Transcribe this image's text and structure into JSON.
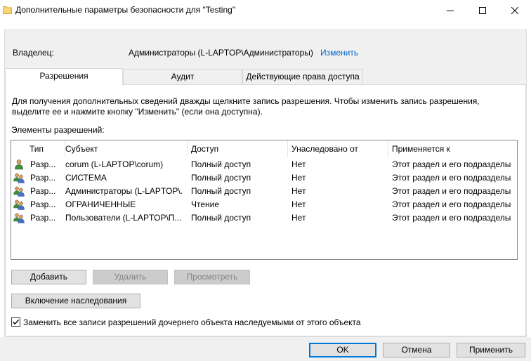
{
  "window": {
    "title": "Дополнительные параметры безопасности  для \"Testing\"",
    "icons": {
      "app": "folder-icon",
      "minimize": "minimize-icon",
      "maximize": "maximize-icon",
      "close": "close-icon"
    }
  },
  "owner": {
    "label": "Владелец:",
    "value": "Администраторы (L-LAPTOP\\Администраторы)",
    "change_link": "Изменить"
  },
  "tabs": [
    {
      "label": "Разрешения",
      "active": true
    },
    {
      "label": "Аудит",
      "active": false
    },
    {
      "label": "Действующие права доступа",
      "active": false
    }
  ],
  "info_text": "Для получения дополнительных сведений дважды щелкните запись разрешения. Чтобы изменить запись разрешения, выделите ее и нажмите кнопку \"Изменить\" (если она доступна).",
  "permissions_label": "Элементы разрешений:",
  "columns": [
    "Тип",
    "Субъект",
    "Доступ",
    "Унаследовано от",
    "Применяется к"
  ],
  "rows": [
    {
      "icon": "user-icon",
      "type": "Разр...",
      "subject": "corum (L-LAPTOP\\corum)",
      "access": "Полный доступ",
      "inherited": "Нет",
      "applies": "Этот раздел и его подразделы"
    },
    {
      "icon": "group-icon",
      "type": "Разр...",
      "subject": "СИСТЕМА",
      "access": "Полный доступ",
      "inherited": "Нет",
      "applies": "Этот раздел и его подразделы"
    },
    {
      "icon": "group-icon",
      "type": "Разр...",
      "subject": "Администраторы (L-LAPTOP\\...",
      "access": "Полный доступ",
      "inherited": "Нет",
      "applies": "Этот раздел и его подразделы"
    },
    {
      "icon": "group-icon",
      "type": "Разр...",
      "subject": "ОГРАНИЧЕННЫЕ",
      "access": "Чтение",
      "inherited": "Нет",
      "applies": "Этот раздел и его подразделы"
    },
    {
      "icon": "group-icon",
      "type": "Разр...",
      "subject": "Пользователи (L-LAPTOP\\П...",
      "access": "Полный доступ",
      "inherited": "Нет",
      "applies": "Этот раздел и его подразделы"
    }
  ],
  "buttons": {
    "add": "Добавить",
    "remove": "Удалить",
    "view": "Просмотреть",
    "enable_inheritance": "Включение наследования",
    "ok": "OK",
    "cancel": "Отмена",
    "apply": "Применить"
  },
  "replace_checkbox": {
    "label": "Заменить все записи разрешений дочернего объекта наследуемыми от этого объекта",
    "checked": true
  }
}
